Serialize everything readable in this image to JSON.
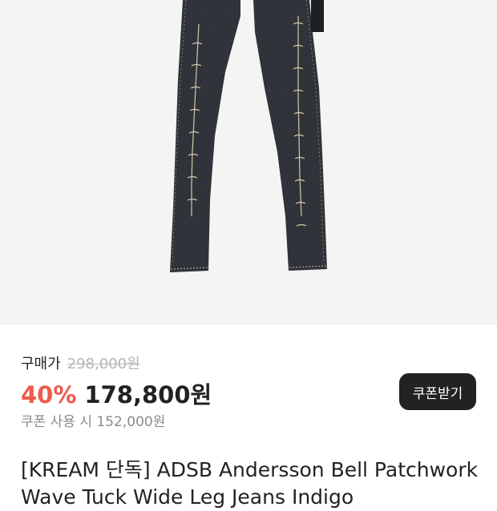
{
  "product": {
    "image_alt": "Indigo wave tuck wide leg jeans",
    "title_line1": "[KREAM 단독] ADSB Andersson Bell Patchwork",
    "title_line2": "Wave Tuck Wide Leg Jeans Indigo"
  },
  "pricing": {
    "purchase_label": "구매가",
    "original_price": "298,000원",
    "discount": "40%",
    "sale_price": "178,800원",
    "coupon_price_text": "쿠폰 사용 시 152,000원"
  },
  "coupon_button": {
    "label": "쿠폰받기"
  },
  "colors": {
    "discount": "#ef5a4e",
    "button_bg": "#222222",
    "denim": "#2b2f35"
  }
}
